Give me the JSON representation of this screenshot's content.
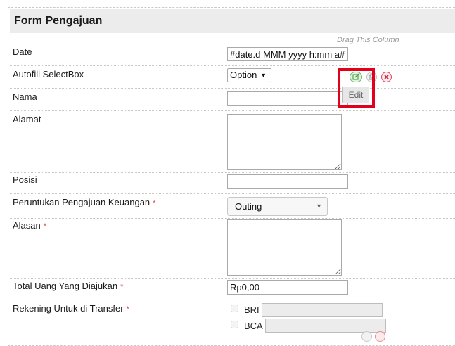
{
  "form": {
    "title": "Form Pengajuan",
    "drag_hint": "Drag This Column"
  },
  "fields": {
    "date": {
      "label": "Date",
      "value": "#date.d MMM yyyy h:mm a#"
    },
    "autofill": {
      "label": "Autofill SelectBox",
      "value": "Option"
    },
    "nama": {
      "label": "Nama",
      "value": ""
    },
    "alamat": {
      "label": "Alamat",
      "value": ""
    },
    "posisi": {
      "label": "Posisi",
      "value": ""
    },
    "peruntukan": {
      "label": "Peruntukan Pengajuan Keuangan",
      "required": "*",
      "value": "Outing"
    },
    "alasan": {
      "label": "Alasan",
      "required": "*",
      "value": ""
    },
    "total": {
      "label": "Total Uang Yang Diajukan",
      "required": "*",
      "value": "Rp0,00"
    },
    "rekening": {
      "label": "Rekening Untuk di Transfer",
      "required": "*",
      "options": [
        {
          "label": "BRI"
        },
        {
          "label": "BCA"
        }
      ]
    }
  },
  "toolbar": {
    "tooltip": "Edit",
    "icons": [
      "edit-icon",
      "copy-icon",
      "delete-icon"
    ],
    "colors": {
      "edit": "#5cb85c",
      "copy": "#9a9a9a",
      "delete": "#e0415a",
      "highlight": "#e3001b"
    }
  }
}
